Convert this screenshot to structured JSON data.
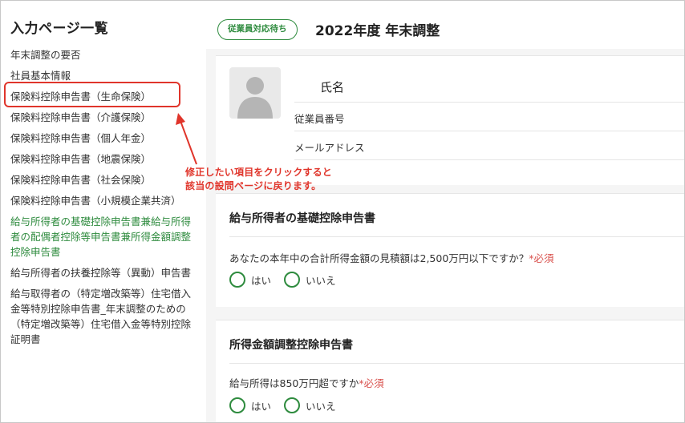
{
  "sidebar": {
    "title": "入力ページ一覧",
    "items": [
      {
        "label": "年末調整の要否",
        "color": "default"
      },
      {
        "label": "社員基本情報",
        "color": "default"
      },
      {
        "label": "保険料控除申告書（生命保険）",
        "color": "default",
        "highlighted": true
      },
      {
        "label": "保険料控除申告書（介護保険）",
        "color": "default"
      },
      {
        "label": "保険料控除申告書（個人年金）",
        "color": "default"
      },
      {
        "label": "保険料控除申告書（地震保険）",
        "color": "default"
      },
      {
        "label": "保険料控除申告書（社会保険）",
        "color": "default"
      },
      {
        "label": "保険料控除申告書（小規模企業共済）",
        "color": "default"
      },
      {
        "label": "給与所得者の基礎控除申告書兼給与所得者の配偶者控除等申告書兼所得金額調整控除申告書",
        "color": "green"
      },
      {
        "label": "給与所得者の扶養控除等（異動）申告書",
        "color": "default"
      },
      {
        "label": "給与取得者の（特定増改築等）住宅借入金等特別控除申告書_年末調整のための（特定増改築等）住宅借入金等特別控除証明書",
        "color": "default"
      }
    ]
  },
  "annotation": {
    "lines": [
      "修正したい項目をクリックすると",
      "該当の設問ページに戻ります。"
    ]
  },
  "header": {
    "status_badge": "従業員対応待ち",
    "title": "2022年度 年末調整"
  },
  "profile": {
    "name_label": "氏名",
    "employee_number_label": "従業員番号",
    "email_label": "メールアドレス"
  },
  "sections": [
    {
      "title": "給与所得者の基礎控除申告書",
      "question": "あなたの本年中の合計所得金額の見積額は2,500万円以下ですか？",
      "required": "*必須",
      "options": [
        "はい",
        "いいえ"
      ]
    },
    {
      "title": "所得金額調整控除申告書",
      "question": "給与所得は850万円超ですか",
      "required": "*必須",
      "options": [
        "はい",
        "いいえ"
      ]
    }
  ],
  "colors": {
    "accent_green": "#2e8b3e",
    "annotation_red": "#e0352b",
    "required_red": "#d9534f"
  }
}
